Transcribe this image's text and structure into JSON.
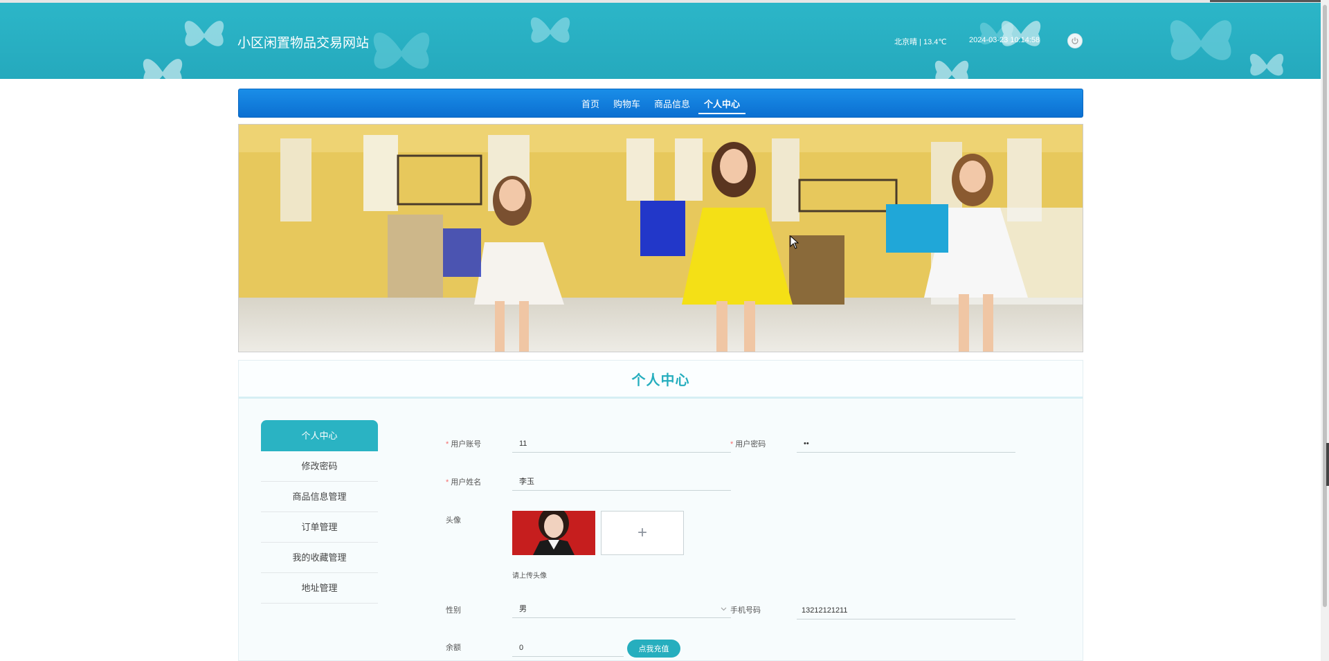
{
  "header": {
    "site_title": "小区闲置物品交易网站",
    "weather": "北京晴 | 13.4℃",
    "datetime": "2024-03-23  10:14:58",
    "logout_icon": "power-icon"
  },
  "nav": {
    "items": [
      {
        "label": "首页"
      },
      {
        "label": "购物车"
      },
      {
        "label": "商品信息"
      },
      {
        "label": "个人中心"
      }
    ],
    "active": "个人中心"
  },
  "section": {
    "title": "个人中心"
  },
  "side_menu": {
    "items": [
      {
        "label": "个人中心"
      },
      {
        "label": "修改密码"
      },
      {
        "label": "商品信息管理"
      },
      {
        "label": "订单管理"
      },
      {
        "label": "我的收藏管理"
      },
      {
        "label": "地址管理"
      }
    ]
  },
  "form": {
    "account_label": "用户账号",
    "account_value": "11",
    "password_label": "用户密码",
    "password_value": "••",
    "name_label": "用户姓名",
    "name_value": "李玉",
    "avatar_label": "头像",
    "avatar_hint": "请上传头像",
    "upload_icon": "+",
    "gender_label": "性别",
    "gender_value": "男",
    "phone_label": "手机号码",
    "phone_value": "13212121211",
    "balance_label": "余额",
    "balance_value": "0",
    "recharge_button": "点我充值"
  },
  "colors": {
    "header": "#2cb6c8",
    "nav": "#0b6fd1",
    "accent": "#26aebe",
    "required": "#f56c6c"
  }
}
